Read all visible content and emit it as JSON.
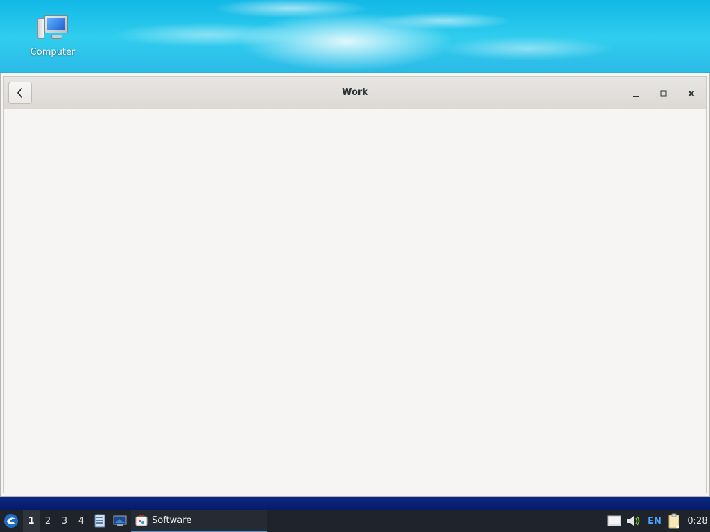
{
  "desktop": {
    "icons": [
      {
        "label": "Computer",
        "icon": "computer-icon"
      }
    ]
  },
  "window": {
    "title": "Work",
    "back_icon": "chevron-left-icon",
    "controls": {
      "minimize": "minimize-icon",
      "maximize": "maximize-icon",
      "close": "close-icon"
    }
  },
  "taskbar": {
    "start_icon": "lxqt-menu-icon",
    "workspaces": [
      "1",
      "2",
      "3",
      "4"
    ],
    "active_workspace": "1",
    "quicklaunch": [
      {
        "icon": "file-manager-icon"
      },
      {
        "icon": "desktop-switch-icon"
      }
    ],
    "tasks": [
      {
        "label": "Software",
        "icon": "software-icon",
        "active": true
      }
    ],
    "tray": {
      "removable_drive_icon": "drive-icon",
      "volume_icon": "volume-icon",
      "keyboard_layout": "EN",
      "clipboard_icon": "clipboard-icon",
      "clock": "0:28"
    },
    "colors": {
      "accent": "#4f8fd6",
      "layout_text": "#4aa3ff"
    }
  }
}
